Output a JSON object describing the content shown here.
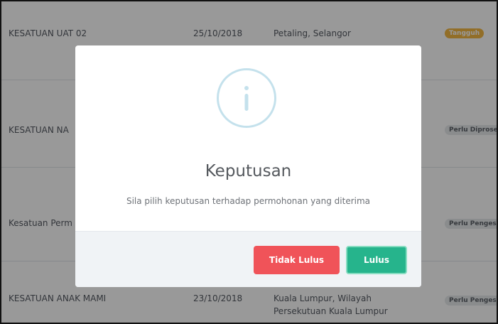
{
  "table": {
    "rows": [
      {
        "name": "KESATUAN UAT 02",
        "date": "25/10/2018",
        "location_lines": [
          "Petaling, Selangor"
        ],
        "status": "Tangguh",
        "status_style": "orange"
      },
      {
        "name": "KESATUAN NA",
        "date": "",
        "location_lines": [],
        "status": "Perlu Diproses",
        "status_style": "grey"
      },
      {
        "name": "Kesatuan Perm",
        "date": "",
        "location_lines": [],
        "status": "Perlu Pengesahan",
        "status_style": "grey"
      },
      {
        "name": "KESATUAN ANAK MAMI",
        "date": "23/10/2018",
        "location_lines": [
          "Kuala Lumpur, Wilayah",
          "Persekutuan Kuala Lumpur"
        ],
        "status": "Perlu Pengesahan",
        "status_style": "grey"
      }
    ]
  },
  "modal": {
    "icon": "info-icon",
    "title": "Keputusan",
    "message": "Sila pilih keputusan terhadap permohonan yang diterima",
    "buttons": {
      "reject_label": "Tidak Lulus",
      "approve_label": "Lulus"
    }
  },
  "colors": {
    "overlay": "#000000",
    "reject": "#f05359",
    "approve": "#26b48c",
    "badge_orange": "#f3b844",
    "badge_grey": "#e7e9ec",
    "info_icon": "#c4e1ec"
  }
}
